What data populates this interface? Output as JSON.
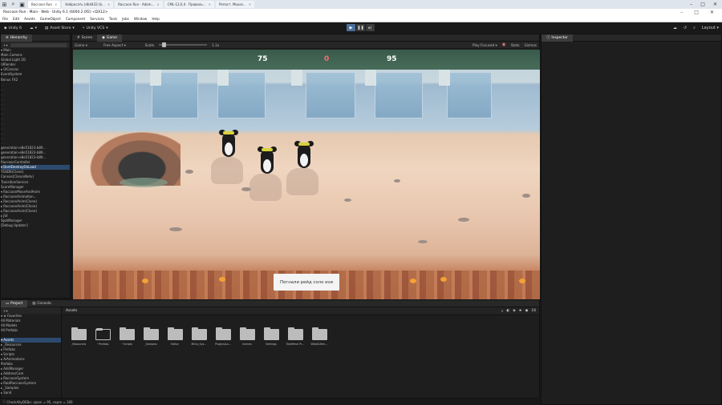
{
  "os_tabs": [
    {
      "label": "Baccoon Run",
      "active": true
    },
    {
      "label": "Набросать (db4433 (b..."
    },
    {
      "label": "Raccoon Run · Adam..."
    },
    {
      "label": "CML-12,0,4 · Проваль..."
    },
    {
      "label": "Репост. Mouse..."
    }
  ],
  "window_title": "Raccoon Run · Main · Web · Unity 6.1 (6000.2.0f2) <DX12>",
  "menu": [
    "File",
    "Edit",
    "Assets",
    "GameObject",
    "Component",
    "Services",
    "Tools",
    "Jobs",
    "Window",
    "Help"
  ],
  "toolbar": {
    "account": "Unity 6",
    "asset_store": "Asset Store",
    "vcs": "Unity VCS",
    "layout": "Layout"
  },
  "hierarchy": {
    "tab": "Hierarchy",
    "rows": [
      {
        "text": "▾ Main",
        "sel": false
      },
      {
        "text": "   Main Camera"
      },
      {
        "text": "   Global Light 2D"
      },
      {
        "text": "   UIRender"
      },
      {
        "text": "    ▸ UICanvas"
      },
      {
        "text": "   EventSystem"
      },
      {
        "text": "   Bonus FX2"
      },
      {
        "text": "   ...",
        "dim": true
      },
      {
        "text": "   ...",
        "dim": true
      },
      {
        "text": "   ...",
        "dim": true
      },
      {
        "text": "   ...",
        "dim": true
      },
      {
        "text": "   ...",
        "dim": true
      },
      {
        "text": "   ...",
        "dim": true
      },
      {
        "text": "   ...",
        "dim": true
      },
      {
        "text": "   ...",
        "dim": true
      },
      {
        "text": "   ...",
        "dim": true
      },
      {
        "text": "   ...",
        "dim": true
      },
      {
        "text": "   ...",
        "dim": true
      },
      {
        "text": "   ...",
        "dim": true
      },
      {
        "text": "   ...",
        "dim": true
      },
      {
        "text": "   generation-e8e51823-b89..."
      },
      {
        "text": "   generation-e8e51823-b89..."
      },
      {
        "text": "   generation-e8e51823-b89..."
      },
      {
        "text": "   RaccoonController"
      },
      {
        "text": "▾ DontDestroyOnLoad",
        "sel": true
      },
      {
        "text": "   YGSDK(Clone)"
      },
      {
        "text": "   Canvas(ClanonNetv)"
      },
      {
        "text": "   TransitionService"
      },
      {
        "text": "   ScoreManager"
      },
      {
        "text": "  ▾ RaccoonMoveAndAnim"
      },
      {
        "text": "    ▸ RaccoonAnimation..."
      },
      {
        "text": "    ▸ RaccoonAnim(Clone)"
      },
      {
        "text": "    ▸ RaccoonAnim(Clone)"
      },
      {
        "text": "    ▸ RaccoonAnim(Clone)"
      },
      {
        "text": "   ▸ JUI"
      },
      {
        "text": "   SpotManager"
      },
      {
        "text": "   [Debug Updater]"
      }
    ]
  },
  "game_view": {
    "tabs": [
      "Scene",
      "Game"
    ],
    "display": "Game",
    "aspect": "Free Aspect",
    "scale_label": "Scale",
    "scale_value": "1.1x",
    "play_focused": "Play Focused",
    "stats": "Stats",
    "gizmos": "Gizmos",
    "scores": [
      "75",
      "0",
      "95"
    ],
    "score_colors": [
      "#ffffff",
      "#ff6a6a",
      "#ffffff"
    ],
    "toast": "Погнали рейд соло изи"
  },
  "inspector": {
    "tab": "Inspector"
  },
  "project": {
    "tabs": [
      "Project",
      "Console"
    ],
    "tree": [
      {
        "text": "▾ ★ Favorites"
      },
      {
        "text": "   All Materials"
      },
      {
        "text": "   All Models"
      },
      {
        "text": "   All Prefabs"
      },
      {
        "text": ""
      },
      {
        "text": "▾ Assets",
        "sel": true
      },
      {
        "text": "  ▸ _Resources"
      },
      {
        "text": "  ▸ Prefabs"
      },
      {
        "text": "  ▾ Scripts"
      },
      {
        "text": "    ▸ AiAnimations"
      },
      {
        "text": "       Prefabs"
      },
      {
        "text": "    ▸ AdsManager"
      },
      {
        "text": "    ▸ AddressCom"
      },
      {
        "text": "    ▸ RaccoonSystem"
      },
      {
        "text": "    ▸ RaidRaccoonSystem"
      },
      {
        "text": "  ▸ _Samples"
      },
      {
        "text": "  ▸ Sand"
      }
    ],
    "assets_label": "Assets",
    "slider_value": "16",
    "folders": [
      {
        "label": "_Resources",
        "open": false
      },
      {
        "label": "~Prefabs",
        "open": true
      },
      {
        "label": "~Scripts",
        "open": false
      },
      {
        "label": "_Samples",
        "open": false
      },
      {
        "label": "Editor",
        "open": false
      },
      {
        "label": "MiGa_Sys...",
        "open": false
      },
      {
        "label": "Plugins/Lo...",
        "open": false
      },
      {
        "label": "Scenes",
        "open": false
      },
      {
        "label": "Settings",
        "open": false
      },
      {
        "label": "TextMesh Pr...",
        "open": false
      },
      {
        "label": "WebGLTem...",
        "open": false
      }
    ]
  },
  "status_bar": "CheckAllyDEBo: ajaan = 95, copro = 100"
}
